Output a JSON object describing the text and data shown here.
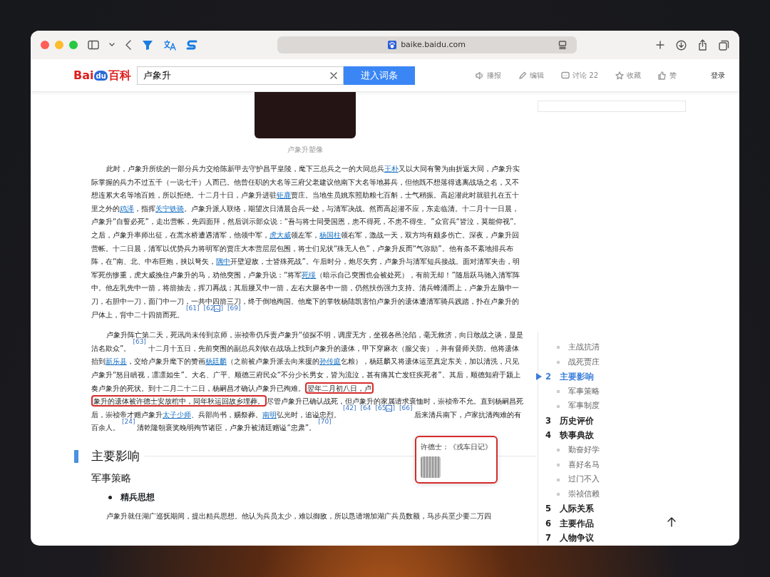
{
  "browser": {
    "url": "baike.baidu.com"
  },
  "header": {
    "logo": [
      "Bai",
      "du",
      "百科"
    ],
    "search": {
      "value": "卢象升"
    },
    "search_button": "进入词条",
    "actions": [
      {
        "label": "播报"
      },
      {
        "label": "编辑"
      },
      {
        "label": "讨论 22"
      },
      {
        "label": "收藏"
      },
      {
        "label": "赞"
      }
    ],
    "login": "登录"
  },
  "article": {
    "image_caption": "卢象升塑像",
    "paragraphs": [
      [
        {
          "kind": "text",
          "text": "此时，卢象升所统的一部分兵力交给陈新甲去守护昌平皇陵，麾下三总兵之一的大同总兵"
        },
        {
          "kind": "link",
          "text": "王朴"
        },
        {
          "kind": "text",
          "text": "又以大同有警为由折返大同，卢象升实际掌握的兵力不过五千（一说七千）人而已。他曾任职的大名等三府父老建议他南下大名等地募兵，但他既不想落得逃离战场之名，又不想连累大名等地百姓，所以拒绝。十二月十日，卢象升进驻"
        },
        {
          "kind": "link",
          "text": "钜鹿"
        },
        {
          "kind": "text",
          "text": "贾庄。当地生员姚东照助粮七百斛，士气稍振。高起潜此时就驻扎在五十里之外的"
        },
        {
          "kind": "link",
          "text": "鸡泽"
        },
        {
          "kind": "text",
          "text": "，指挥"
        },
        {
          "kind": "link",
          "text": "关宁铁骑"
        },
        {
          "kind": "text",
          "text": "。卢象升派人联络，期望次日清晨合兵一处，与清军决战。然而高起潜不应，东走临清。十二月十一日晨，卢象升“自誓必死”，走出营帐，先四面拜，然后训示部众说：“吾与将士同受国恩，患不得死，不患不得生。”众官兵“皆泣，莫能仰视”。之后，卢象升率师出征，在蒿水桥遭遇清军，他领中军，"
        },
        {
          "kind": "link",
          "text": "虎大威"
        },
        {
          "kind": "text",
          "text": "领左军，"
        },
        {
          "kind": "link",
          "text": "杨国柱"
        },
        {
          "kind": "text",
          "text": "领右军，激战一天，双方均有颇多伤亡。深夜，卢象升回营帐。十二日晨，清军以优势兵力将明军的贾庄大本营层层包围，将士们见状“殊无人色”，卢象升反而“气弥励”。他有条不紊地排兵布阵，在“南、北、中布巨炮，挟以弩矢，"
        },
        {
          "kind": "link",
          "text": "隅中"
        },
        {
          "kind": "text",
          "text": "开壁迎敌，士皆殊死战”。午后时分，炮尽矢穷，卢象升与清军短兵接战。面对清军夹击，明军死伤惨重，虎大威挽住卢象升的马，劝他突围，卢象升说：“将军"
        },
        {
          "kind": "link",
          "text": "死绥"
        },
        {
          "kind": "text",
          "text": "（暗示自己突围也会被处死），有前无却！”随后跃马驰入清军阵中。他左乳先中一箭，将箭抽去，挥刀再战；其后腰又中一箭，左右大腿各中一箭，仍然扶伤强力支持。清兵蜂涌而上，卢象升左脑中一刀，右胆中一刀，面门中一刀，一共中四箭三刀，终于倒地殉国。他麾下的掌牧杨陆凯害怕卢象升的遗体遭清军骑兵践踏，扑在卢象升的尸体上，背中二十四箭而死。"
        },
        {
          "kind": "ref",
          "text": "[61]"
        },
        {
          "kind": "ref",
          "text": "[62",
          "image": true,
          "after": "]"
        },
        {
          "kind": "ref",
          "text": "[69]"
        }
      ],
      [
        {
          "kind": "text",
          "text": "卢象升阵亡第二天，死讯尚未传到京师，崇祯帝仍斥责卢象升“侦探不明，调度无方，坐视各邑沦陷，毫无救济，向日敢战之谈，显是沽名欺众”。"
        },
        {
          "kind": "ref",
          "text": "[63]"
        },
        {
          "kind": "text",
          "text": "十二月十五日，先前突围的副总兵刘钦在战场上找到卢象升的遗体，甲下穿麻衣（服父丧），并有督师关防。他将遗体抬到"
        },
        {
          "kind": "link",
          "text": "新乐县"
        },
        {
          "kind": "text",
          "text": "，交给卢象升麾下的赞画"
        },
        {
          "kind": "link",
          "text": "杨廷麟"
        },
        {
          "kind": "text",
          "text": "（之前被卢象升派去向来援的"
        },
        {
          "kind": "link",
          "text": "孙传庭"
        },
        {
          "kind": "text",
          "text": "乞粮），杨廷麟又将遗体运至真定东关，加以清洗，只见卢象升“怒目瞋视，凛凛如生”。大名、广平、顺德三府民众“不分少长男女，皆为流泣，甚有痛其亡发狂疾死者”。其后，顺德知府于颍上奏卢象升的死状。到十二月二十二日，杨嗣昌才确认卢象升已殉难。"
        },
        {
          "kind": "marked",
          "text": "翌年二月初八日，卢"
        },
        {
          "kind": "marked",
          "text": "象升的遗体被许德士安放棺中，同年秋运回故乡埋葬。"
        },
        {
          "kind": "text",
          "text": "尽管卢象升已确认战死，但卢象升的家属请求褒恤时，崇祯帝不允。直到杨嗣昌死后，崇祯帝才赠卢象升"
        },
        {
          "kind": "link",
          "text": "太子少师"
        },
        {
          "kind": "text",
          "text": "、兵部尚书，赐祭葬。"
        },
        {
          "kind": "link",
          "text": "南明"
        },
        {
          "kind": "text",
          "text": "弘光时，追谥忠烈。"
        },
        {
          "kind": "ref",
          "text": "[42]"
        },
        {
          "kind": "ref",
          "text": "[64"
        },
        {
          "kind": "ref",
          "text": "[65",
          "image": true,
          "after": "]",
          "popup": {
            "label": "许德士：《戎车日记》",
            "highlighted": true
          }
        },
        {
          "kind": "ref",
          "text": "[66]"
        },
        {
          "kind": "text",
          "text": "后来清兵南下，卢家抗清殉难的有百余人。"
        },
        {
          "kind": "ref",
          "text": "[24]"
        },
        {
          "kind": "text",
          "text": "清乾隆朝褒奖晚明殉节诸臣，卢象升被清廷赠谥“忠肃”。"
        },
        {
          "kind": "ref",
          "text": "[70]"
        }
      ]
    ],
    "section_title": "主要影响",
    "subsection_title": "军事策略",
    "bullet": "精兵思想",
    "last_paragraph": "卢象升就任湖广巡抚期间，提出精兵思想。他认为兵员太少，难以御敌，所以恳请增加湖广兵员数额，马步兵至少要二万四"
  },
  "toc": [
    {
      "children": [
        {
          "title": "主战抗清",
          "selected": false
        },
        {
          "title": "战死贾庄",
          "selected": false
        }
      ]
    },
    {
      "number": "2",
      "title": "主要影响",
      "selected": true,
      "children": [
        {
          "title": "军事策略",
          "selected": false
        },
        {
          "title": "军事制度",
          "selected": false
        }
      ]
    },
    {
      "number": "3",
      "title": "历史评价",
      "selected": false
    },
    {
      "number": "4",
      "title": "轶事典故",
      "selected": false,
      "children": [
        {
          "title": "勤奋好学",
          "selected": false
        },
        {
          "title": "喜好名马",
          "selected": false
        },
        {
          "title": "过门不入",
          "selected": false
        },
        {
          "title": "崇祯信赖",
          "selected": false
        }
      ]
    },
    {
      "number": "5",
      "title": "人际关系",
      "selected": false
    },
    {
      "number": "6",
      "title": "主要作品",
      "selected": false
    },
    {
      "number": "7",
      "title": "人物争议",
      "selected": false
    }
  ]
}
